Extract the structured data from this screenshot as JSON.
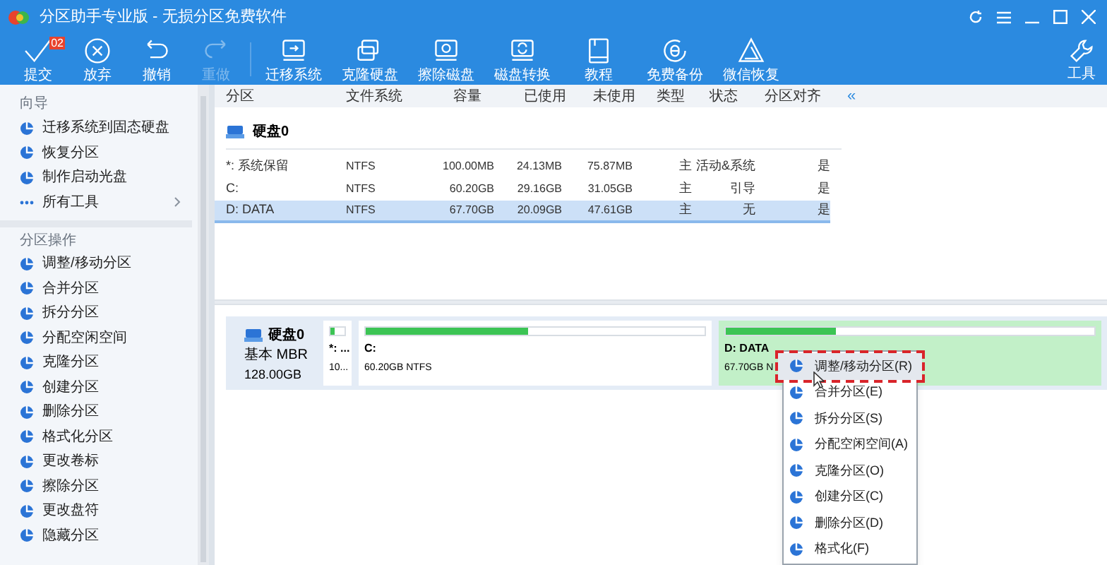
{
  "window": {
    "title": "分区助手专业版 - 无损分区免费软件"
  },
  "toolbar": [
    {
      "label": "提交",
      "badge": "02",
      "disabled": false
    },
    {
      "label": "放弃",
      "disabled": false
    },
    {
      "label": "撤销",
      "disabled": false
    },
    {
      "label": "重做",
      "disabled": true
    },
    {
      "label": "迁移系统",
      "disabled": false
    },
    {
      "label": "克隆硬盘",
      "disabled": false
    },
    {
      "label": "擦除磁盘",
      "disabled": false
    },
    {
      "label": "磁盘转换",
      "disabled": false
    },
    {
      "label": "教程",
      "disabled": false
    },
    {
      "label": "免费备份",
      "disabled": false
    },
    {
      "label": "微信恢复",
      "disabled": false
    }
  ],
  "tools_button": {
    "label": "工具"
  },
  "sidebar": {
    "sections": [
      {
        "title": "向导",
        "items": [
          {
            "label": "迁移系统到固态硬盘"
          },
          {
            "label": "恢复分区"
          },
          {
            "label": "制作启动光盘"
          },
          {
            "label": "所有工具",
            "has_submenu": true
          }
        ]
      },
      {
        "title": "分区操作",
        "items": [
          {
            "label": "调整/移动分区"
          },
          {
            "label": "合并分区"
          },
          {
            "label": "拆分分区"
          },
          {
            "label": "分配空闲空间"
          },
          {
            "label": "克隆分区"
          },
          {
            "label": "创建分区"
          },
          {
            "label": "删除分区"
          },
          {
            "label": "格式化分区"
          },
          {
            "label": "更改卷标"
          },
          {
            "label": "擦除分区"
          },
          {
            "label": "更改盘符"
          },
          {
            "label": "隐藏分区"
          }
        ]
      }
    ]
  },
  "table": {
    "columns": [
      "分区",
      "文件系统",
      "容量",
      "已使用",
      "未使用",
      "类型",
      "状态",
      "分区对齐"
    ],
    "collapse": "«",
    "disk": "硬盘0",
    "rows": [
      {
        "cells": [
          "*: 系统保留",
          "NTFS",
          "100.00MB",
          "24.13MB",
          "75.87MB",
          "主",
          "活动&系统",
          "是"
        ],
        "selected": false
      },
      {
        "cells": [
          "C:",
          "NTFS",
          "60.20GB",
          "29.16GB",
          "31.05GB",
          "主",
          "引导",
          "是"
        ],
        "selected": false
      },
      {
        "cells": [
          "D: DATA",
          "NTFS",
          "67.70GB",
          "20.09GB",
          "47.61GB",
          "主",
          "无",
          "是"
        ],
        "selected": true
      }
    ]
  },
  "disk_map": {
    "disk": {
      "name": "硬盘0",
      "type": "基本 MBR",
      "size": "128.00GB"
    },
    "partitions": [
      {
        "name": "*: ...",
        "info": "10...",
        "level": 0.3,
        "selected": false
      },
      {
        "name": "C:",
        "info": "60.20GB NTFS",
        "level": 0.48,
        "selected": false
      },
      {
        "name": "D: DATA",
        "info": "67.70GB N",
        "level": 0.3,
        "selected": true
      }
    ]
  },
  "context_menu": [
    {
      "label": "调整/移动分区(R)",
      "selected": true
    },
    {
      "label": "合并分区(E)",
      "selected": false
    },
    {
      "label": "拆分分区(S)",
      "selected": false
    },
    {
      "label": "分配空闲空间(A)",
      "selected": false
    },
    {
      "label": "克隆分区(O)",
      "selected": false
    },
    {
      "label": "创建分区(C)",
      "selected": false
    },
    {
      "label": "删除分区(D)",
      "selected": false
    },
    {
      "label": "格式化(F)",
      "selected": false
    }
  ]
}
